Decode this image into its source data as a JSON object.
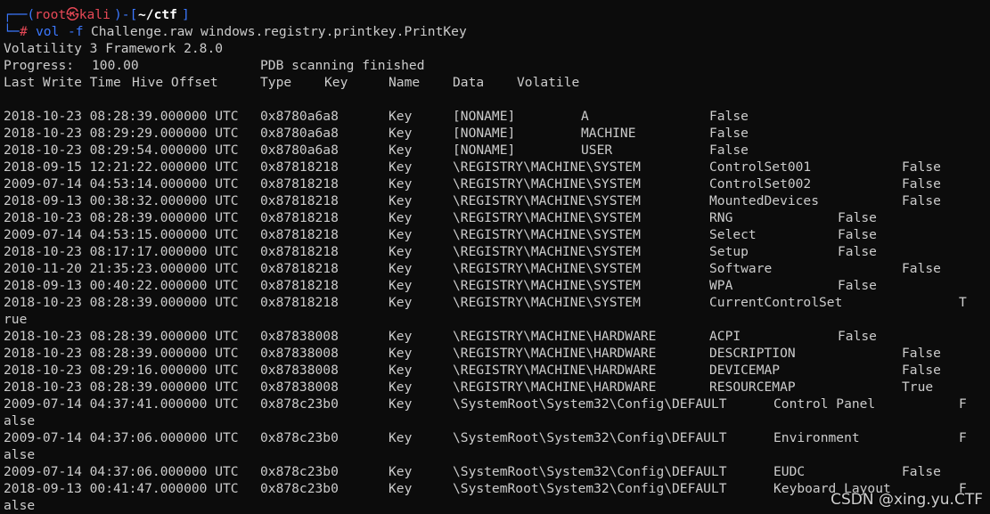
{
  "prompt": {
    "top_prefix": "┌──(",
    "user": "root㉿kali",
    "mid": ")-[",
    "dir": "~/ctf",
    "end": "]",
    "cmd_prefix": "└─",
    "hash": "#",
    "cmd_vol": "vol",
    "cmd_flag": "-f",
    "cmd_rest": "Challenge.raw windows.registry.printkey.PrintKey"
  },
  "header": {
    "version": "Volatility 3 Framework 2.8.0",
    "progress_label": "Progress:",
    "progress_value": "100.00",
    "progress_status": "PDB scanning finished",
    "columns": [
      "Last Write Time",
      "Hive Offset",
      "Type",
      "Key",
      "Name",
      "Data",
      "Volatile"
    ]
  },
  "rows": [
    {
      "time": "2018-10-23 08:28:39.000000 UTC",
      "offset": "0x8780a6a8",
      "type": "Key",
      "key": "[NONAME]",
      "name": "A",
      "tail": "False",
      "wrap": ""
    },
    {
      "time": "2018-10-23 08:29:29.000000 UTC",
      "offset": "0x8780a6a8",
      "type": "Key",
      "key": "[NONAME]",
      "name": "MACHINE",
      "tail": "False",
      "wrap": ""
    },
    {
      "time": "2018-10-23 08:29:54.000000 UTC",
      "offset": "0x8780a6a8",
      "type": "Key",
      "key": "[NONAME]",
      "name": "USER",
      "tail": "False",
      "wrap": ""
    },
    {
      "time": "2018-09-15 12:21:22.000000 UTC",
      "offset": "0x87818218",
      "type": "Key",
      "key": "\\REGISTRY\\MACHINE\\SYSTEM",
      "name": "ControlSet001",
      "tail": "False",
      "wrap": ""
    },
    {
      "time": "2009-07-14 04:53:14.000000 UTC",
      "offset": "0x87818218",
      "type": "Key",
      "key": "\\REGISTRY\\MACHINE\\SYSTEM",
      "name": "ControlSet002",
      "tail": "False",
      "wrap": ""
    },
    {
      "time": "2018-09-13 00:38:32.000000 UTC",
      "offset": "0x87818218",
      "type": "Key",
      "key": "\\REGISTRY\\MACHINE\\SYSTEM",
      "name": "MountedDevices",
      "tail": "False",
      "wrap": ""
    },
    {
      "time": "2018-10-23 08:28:39.000000 UTC",
      "offset": "0x87818218",
      "type": "Key",
      "key": "\\REGISTRY\\MACHINE\\SYSTEM",
      "name": "RNG",
      "tail": "False",
      "wrap": ""
    },
    {
      "time": "2009-07-14 04:53:15.000000 UTC",
      "offset": "0x87818218",
      "type": "Key",
      "key": "\\REGISTRY\\MACHINE\\SYSTEM",
      "name": "Select",
      "tail": "False",
      "wrap": ""
    },
    {
      "time": "2018-10-23 08:17:17.000000 UTC",
      "offset": "0x87818218",
      "type": "Key",
      "key": "\\REGISTRY\\MACHINE\\SYSTEM",
      "name": "Setup",
      "tail": "False",
      "wrap": ""
    },
    {
      "time": "2010-11-20 21:35:23.000000 UTC",
      "offset": "0x87818218",
      "type": "Key",
      "key": "\\REGISTRY\\MACHINE\\SYSTEM",
      "name": "Software",
      "tail": "False",
      "wrap": ""
    },
    {
      "time": "2018-09-13 00:40:22.000000 UTC",
      "offset": "0x87818218",
      "type": "Key",
      "key": "\\REGISTRY\\MACHINE\\SYSTEM",
      "name": "WPA",
      "tail": "False",
      "wrap": ""
    },
    {
      "time": "2018-10-23 08:28:39.000000 UTC",
      "offset": "0x87818218",
      "type": "Key",
      "key": "\\REGISTRY\\MACHINE\\SYSTEM",
      "name": "CurrentControlSet",
      "tail": "T",
      "wrap": "rue"
    },
    {
      "time": "2018-10-23 08:28:39.000000 UTC",
      "offset": "0x87838008",
      "type": "Key",
      "key": "\\REGISTRY\\MACHINE\\HARDWARE",
      "name": "ACPI",
      "tail": "False",
      "wrap": ""
    },
    {
      "time": "2018-10-23 08:28:39.000000 UTC",
      "offset": "0x87838008",
      "type": "Key",
      "key": "\\REGISTRY\\MACHINE\\HARDWARE",
      "name": "DESCRIPTION",
      "tail": "False",
      "wrap": ""
    },
    {
      "time": "2018-10-23 08:29:16.000000 UTC",
      "offset": "0x87838008",
      "type": "Key",
      "key": "\\REGISTRY\\MACHINE\\HARDWARE",
      "name": "DEVICEMAP",
      "tail": "False",
      "wrap": ""
    },
    {
      "time": "2018-10-23 08:28:39.000000 UTC",
      "offset": "0x87838008",
      "type": "Key",
      "key": "\\REGISTRY\\MACHINE\\HARDWARE",
      "name": "RESOURCEMAP",
      "tail": "True",
      "wrap": ""
    },
    {
      "time": "2009-07-14 04:37:41.000000 UTC",
      "offset": "0x878c23b0",
      "type": "Key",
      "key": "\\SystemRoot\\System32\\Config\\DEFAULT",
      "name": "Control Panel",
      "tail": "F",
      "wrap": "alse"
    },
    {
      "time": "2009-07-14 04:37:06.000000 UTC",
      "offset": "0x878c23b0",
      "type": "Key",
      "key": "\\SystemRoot\\System32\\Config\\DEFAULT",
      "name": "Environment",
      "tail": "F",
      "wrap": "alse"
    },
    {
      "time": "2009-07-14 04:37:06.000000 UTC",
      "offset": "0x878c23b0",
      "type": "Key",
      "key": "\\SystemRoot\\System32\\Config\\DEFAULT",
      "name": "EUDC",
      "tail": "False",
      "wrap": ""
    },
    {
      "time": "2018-09-13 00:41:47.000000 UTC",
      "offset": "0x878c23b0",
      "type": "Key",
      "key": "\\SystemRoot\\System32\\Config\\DEFAULT",
      "name": "Keyboard Layout",
      "tail": "F",
      "wrap": "alse"
    }
  ],
  "watermark": "CSDN @xing.yu.CTF",
  "colors": {
    "background": "#0c0c0c",
    "foreground": "#cccccc",
    "prompt_blue": "#3b78ff",
    "prompt_red": "#e74856"
  }
}
